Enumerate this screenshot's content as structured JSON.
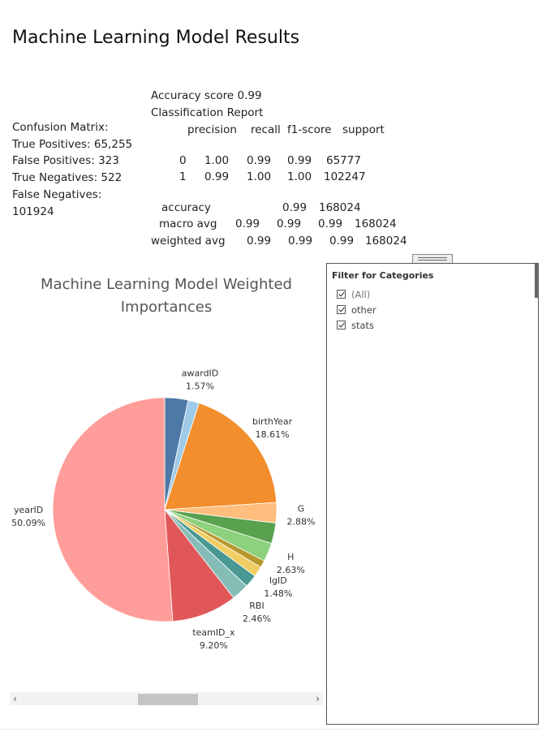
{
  "page_title": "Machine Learning Model Results",
  "confusion_matrix": {
    "label": "Confusion Matrix:",
    "true_positives": "True Positives: 65,255",
    "false_positives": "False Positives: 323",
    "true_negatives": "True Negatives: 522",
    "false_negatives_label": "False Negatives:",
    "false_negatives_value": "101924"
  },
  "classification_report": {
    "accuracy_score": "Accuracy score 0.99",
    "title": "Classification Report",
    "headers": [
      "precision",
      "recall",
      "f1-score",
      "support"
    ],
    "rows": [
      {
        "label": "0",
        "precision": "1.00",
        "recall": "0.99",
        "f1": "0.99",
        "support": "65777"
      },
      {
        "label": "1",
        "precision": "0.99",
        "recall": "1.00",
        "f1": "1.00",
        "support": "102247"
      }
    ],
    "accuracy_row": {
      "label": "accuracy",
      "value": "0.99",
      "support": "168024"
    },
    "macro_avg": {
      "label": "macro avg",
      "precision": "0.99",
      "recall": "0.99",
      "f1": "0.99",
      "support": "168024"
    },
    "weighted_avg": {
      "label": "weighted avg",
      "precision": "0.99",
      "recall": "0.99",
      "f1": "0.99",
      "support": "168024"
    }
  },
  "chart_data": {
    "type": "pie",
    "title": "Machine Learning Model Weighted Importances",
    "start": "top",
    "direction": "clockwise",
    "slices": [
      {
        "name": "",
        "value": 3.3,
        "color": "#4e79a7",
        "label": ""
      },
      {
        "name": "awardID",
        "value": 1.57,
        "color": "#a0cbe8",
        "label": "1.57%"
      },
      {
        "name": "birthYear",
        "value": 18.61,
        "color": "#f28e2b",
        "label": "18.61%"
      },
      {
        "name": "G",
        "value": 2.88,
        "color": "#ffbe7d",
        "label": "2.88%"
      },
      {
        "name": "",
        "value": 2.9,
        "color": "#59a14f",
        "label": ""
      },
      {
        "name": "H",
        "value": 2.63,
        "color": "#8cd17d",
        "label": "2.63%"
      },
      {
        "name": "",
        "value": 1.0,
        "color": "#b6992d",
        "label": ""
      },
      {
        "name": "lgID",
        "value": 1.48,
        "color": "#f1ce63",
        "label": "1.48%"
      },
      {
        "name": "",
        "value": 1.8,
        "color": "#499894",
        "label": ""
      },
      {
        "name": "RBI",
        "value": 2.46,
        "color": "#86bcb6",
        "label": "2.46%"
      },
      {
        "name": "teamID_x",
        "value": 9.2,
        "color": "#e15759",
        "label": "9.20%"
      },
      {
        "name": "yearID",
        "value": 50.09,
        "color": "#ff9d9a",
        "label": "50.09%"
      }
    ]
  },
  "filter": {
    "title": "Filter for Categories",
    "items": [
      {
        "label": "(All)",
        "checked": true
      },
      {
        "label": "other",
        "checked": true
      },
      {
        "label": "stats",
        "checked": true
      }
    ]
  },
  "scrollbar": {
    "left_arrow": "‹",
    "right_arrow": "›"
  }
}
